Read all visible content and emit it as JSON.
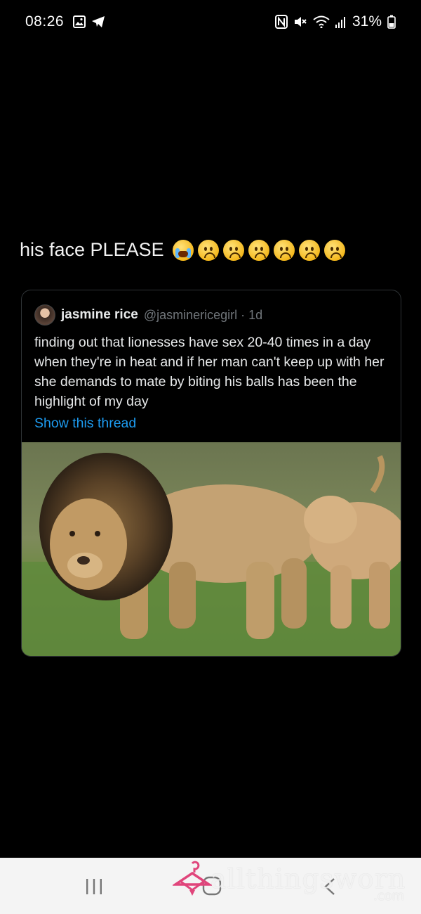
{
  "status_bar": {
    "time": "08:26",
    "left_icons": [
      "gallery-icon",
      "telegram-icon"
    ],
    "right_icons": [
      "nfc-icon",
      "mute-icon",
      "wifi-icon",
      "signal-icon",
      "battery-icon"
    ],
    "battery": "31%"
  },
  "caption": {
    "text": "his face PLEASE",
    "emojis": [
      "loudly-crying-face",
      "frowning-face",
      "frowning-face",
      "frowning-face",
      "frowning-face",
      "frowning-face",
      "frowning-face"
    ]
  },
  "tweet": {
    "name": "jasmine rice",
    "handle_time": "@jasminericegirl · 1d",
    "body": "finding out that lionesses have sex 20-40 times in a day when they're in heat and if her man can't keep up with her she demands to mate by biting his balls has been the highlight of my day",
    "show_thread": "Show this thread",
    "link_color": "#1d9bf0"
  },
  "nav_bar": {
    "buttons": [
      "recents-icon",
      "home-icon",
      "back-icon"
    ]
  },
  "watermark": {
    "text": "allthingsworn",
    "suffix": ".com",
    "color": "#e0457b"
  }
}
